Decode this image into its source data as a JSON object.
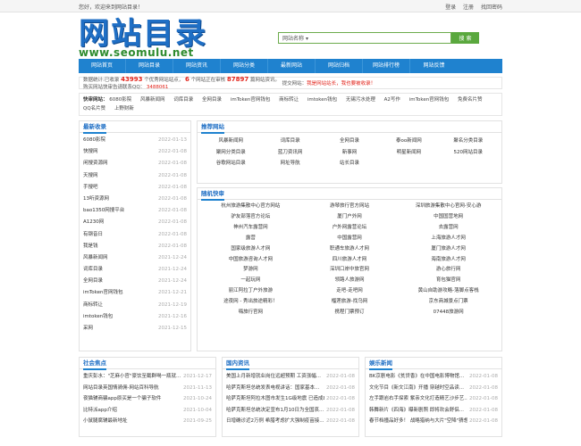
{
  "topbar": {
    "welcome": "您好，欢迎来到网站目录！",
    "login": "登录",
    "register": "注册",
    "forgot": "找回密码"
  },
  "logo": {
    "cn": "网站目录",
    "en": "www.seomulu.net"
  },
  "search": {
    "select": "网站名称",
    "button": "搜 索"
  },
  "nav": [
    "网站首页",
    "网站目录",
    "网站资讯",
    "网站分类",
    "最新网站",
    "网站归档",
    "网站排行榜",
    "网站反馈"
  ],
  "stats": {
    "prefix": "数据统计:已收录",
    "count1": "43993",
    "mid1": "个优秀网站站点，",
    "count2": "6",
    "mid2": "个网站正在审核",
    "count3": "87897",
    "mid3": "篇网站资讯。购买网站快审告请联系QQ：",
    "qq": "3488061",
    "notice_label": "提交网站：",
    "notice": "我是网站站长，我也要被收录！"
  },
  "friends": {
    "label": "快审网站：",
    "items": [
      "6080影院",
      "风暴新闻网",
      "词库目录",
      "全网目录",
      "imToken官网钱包",
      "商标转让",
      "imtoken钱包",
      "无锡污水处理",
      "A2写作",
      "imToken官网钱包",
      "免费名片赞",
      "QQ名片赞",
      "上野财新"
    ]
  },
  "recent": {
    "title": "最新收录",
    "items": [
      {
        "name": "6080影院",
        "date": "2022-01-13"
      },
      {
        "name": "快搜网",
        "date": "2022-01-08"
      },
      {
        "name": "闲搜资源网",
        "date": "2022-01-08"
      },
      {
        "name": "天搜网",
        "date": "2022-01-08"
      },
      {
        "name": "手搜吧",
        "date": "2022-01-08"
      },
      {
        "name": "13听资源网",
        "date": "2022-01-08"
      },
      {
        "name": "bao1350网搜平台",
        "date": "2022-01-08"
      },
      {
        "name": "A1230网",
        "date": "2022-01-08"
      },
      {
        "name": "有钢音日",
        "date": "2022-01-08"
      },
      {
        "name": "我是钱",
        "date": "2022-01-08"
      },
      {
        "name": "风暴新闻网",
        "date": "2021-12-24"
      },
      {
        "name": "词库目录",
        "date": "2021-12-24"
      },
      {
        "name": "全网目录",
        "date": "2021-12-24"
      },
      {
        "name": "imToken官网钱包",
        "date": "2021-12-21"
      },
      {
        "name": "商标转让",
        "date": "2021-12-19"
      },
      {
        "name": "imtoken钱包",
        "date": "2021-12-16"
      },
      {
        "name": "采网",
        "date": "2021-12-15"
      }
    ]
  },
  "recommend": {
    "title": "推荐网站",
    "items": [
      "风暴新闻网",
      "词库目录",
      "全网目录",
      "泰oo新闻网",
      "聚名分类目录",
      "聚网分类目录",
      "蓝刀资讯网",
      "新事网",
      "明星新闻网",
      "520网站目录",
      "谷歌网站目录",
      "网址导航",
      "站长目录"
    ]
  },
  "random": {
    "title": "随机快审",
    "items": [
      "杭州旅游集散中心官方网站",
      "游琴旅行官方网站",
      "深圳旅游集散中心官网-安心游",
      "驴友部落官方论坛",
      "厦门户外网",
      "中国国营地网",
      "神州汽车露营网",
      "户外网露营论坛",
      "去露营网",
      "露营",
      "中国露营网",
      "上海旅游人才网",
      "国家级旅游人才网",
      "职通车旅游人才网",
      "厦门旅游人才网",
      "中国旅游咨询人才网",
      "四川旅游人才网",
      "海南旅游人才网",
      "梦游网",
      "深圳口岸中旅官网",
      "游心旅行网",
      "一起玩网",
      "领路人旅游网",
      "育包猫官网",
      "丽江阿拉丁户外旅游",
      "走吧-走吧网",
      "黄山自助游攻略-落脚点客栈",
      "途夜网 - 秀出旅途精彩！",
      "榴莲旅游-找乌网",
      "京东商城景点门票",
      "嗨旅行官网",
      "携程门票预订",
      "07448旅游网"
    ]
  },
  "news": [
    {
      "title": "社会焦点",
      "items": [
        {
          "t": "重庆彭水：\"芝麻小官\"豪饮至截群喝一瓶就...",
          "d": "2021-12-17"
        },
        {
          "t": "网站目录英国情骑佣-网站百科导航",
          "d": "2021-11-13"
        },
        {
          "t": "夜猫辅商骗app原买是一个骗子软件",
          "d": "2021-10-24"
        },
        {
          "t": "比特派app介绍",
          "d": "2021-10-04"
        },
        {
          "t": "小鼠腿腐辅最新地址",
          "d": "2021-09-25"
        }
      ]
    },
    {
      "title": "国内资讯",
      "items": [
        {
          "t": "美国上月新增就业岗位远超预期 工资涨幅...",
          "d": "2022-01-08"
        },
        {
          "t": "哈萨克斯坦总统发表电视讲话：国家基本...",
          "d": "2022-01-08"
        },
        {
          "t": "哈萨克斯坦阿拉木图市发生1G级地震 已造成8人受伤",
          "d": "2022-01-08"
        },
        {
          "t": "哈萨克斯坦总统决定宣布1月10日为全国哀...",
          "d": "2022-01-08"
        },
        {
          "t": "日增确诊近2万例 希腊考虑扩大强制疫苗接...",
          "d": "2022-01-08"
        }
      ]
    },
    {
      "title": "娱乐新闻",
      "items": [
        {
          "t": "BK京剧电影《贫贷香》在中国电影博物馆...",
          "d": "2022-01-08"
        },
        {
          "t": "文化节目《新文江南》开播 穿越时空品读...",
          "d": "2022-01-08"
        },
        {
          "t": "左手跟岩右手探索 紫亲文化打造精艺沙步艺...",
          "d": "2022-01-08"
        },
        {
          "t": "韩舞新片《四海》曝新剧照 即将欢会舒侣...",
          "d": "2022-01-08"
        },
        {
          "t": "春节档撞品好多！ 战略猎纳与大片\"空降\"猜想...",
          "d": "2022-01-08"
        }
      ]
    }
  ]
}
